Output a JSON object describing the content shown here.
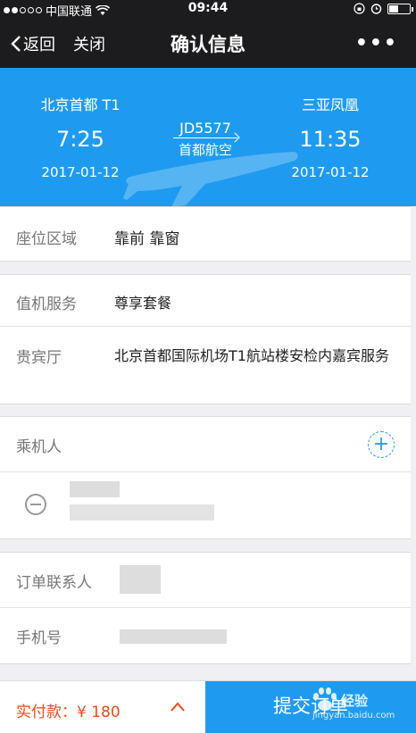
{
  "status_bar": {
    "carrier": "中国联通",
    "time": "09:44"
  },
  "nav": {
    "back_label": "返回",
    "close_label": "关闭",
    "title": "确认信息",
    "more_label": "•••"
  },
  "flight": {
    "departure": {
      "airport": "北京首都 T1",
      "time": "7:25",
      "date": "2017-01-12"
    },
    "arrival": {
      "airport": "三亚凤凰",
      "time": "11:35",
      "date": "2017-01-12"
    },
    "flight_no": "JD5577",
    "airline": "首都航空"
  },
  "seat": {
    "label": "座位区域",
    "value": "靠前 靠窗"
  },
  "services": {
    "checkin_label": "值机服务",
    "checkin_value": "尊享套餐",
    "lounge_label": "贵宾厅",
    "lounge_value": "北京首都国际机场T1航站楼安检内嘉宾服务"
  },
  "passengers": {
    "label": "乘机人",
    "add_symbol": "+"
  },
  "contact": {
    "name_label": "订单联系人",
    "phone_label": "手机号"
  },
  "bottom": {
    "pay_label": "实付款：¥ 180",
    "submit_label": "提交订单"
  },
  "watermark": {
    "brand": "经验",
    "url": "jingyan.baidu.com"
  },
  "colors": {
    "accent": "#1e9bf0",
    "price": "#f04a1a",
    "nav_bg": "#1c1c1e"
  }
}
